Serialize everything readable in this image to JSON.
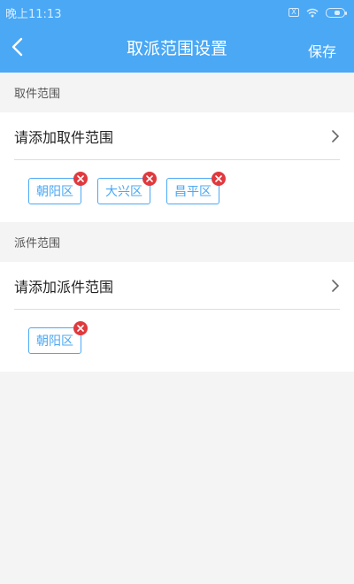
{
  "status_bar": {
    "time": "晚上11:13",
    "sim": "X"
  },
  "nav": {
    "title": "取派范围设置",
    "save_label": "保存"
  },
  "pickup": {
    "section_label": "取件范围",
    "add_label": "请添加取件范围",
    "tags": [
      "朝阳区",
      "大兴区",
      "昌平区"
    ]
  },
  "dispatch": {
    "section_label": "派件范围",
    "add_label": "请添加派件范围",
    "tags": [
      "朝阳区"
    ]
  },
  "colors": {
    "primary": "#4aa8f5",
    "remove": "#e0393e"
  }
}
